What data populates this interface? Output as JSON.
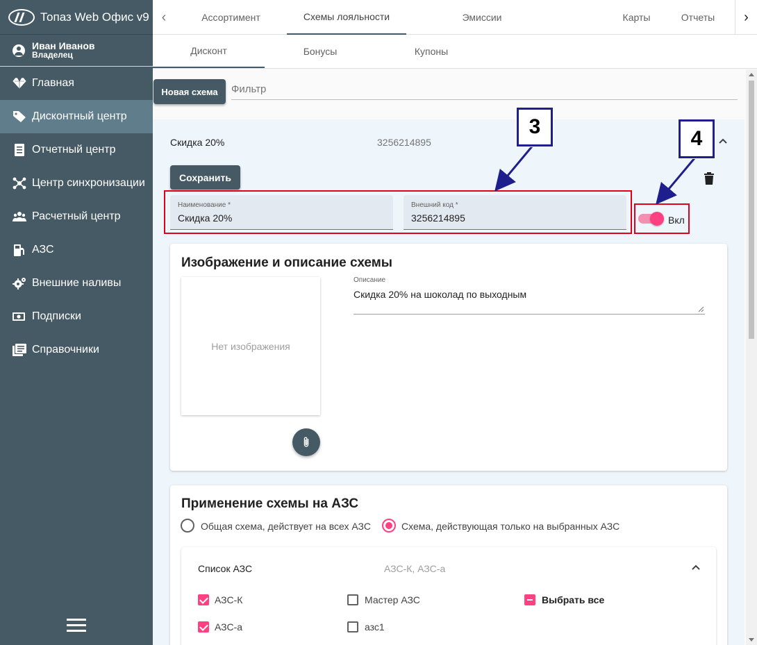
{
  "app": {
    "title": "Топаз Web Офис v9",
    "user_name": "Иван Иванов",
    "user_role": "Владелец"
  },
  "sidebar": {
    "items": [
      {
        "label": "Главная",
        "icon": "diamond-icon"
      },
      {
        "label": "Дисконтный центр",
        "icon": "tag-icon"
      },
      {
        "label": "Отчетный центр",
        "icon": "report-icon"
      },
      {
        "label": "Центр синхронизации",
        "icon": "sync-hub-icon"
      },
      {
        "label": "Расчетный центр",
        "icon": "people-icon"
      },
      {
        "label": "АЗС",
        "icon": "fuel-station-icon"
      },
      {
        "label": "Внешние наливы",
        "icon": "gear-icon"
      },
      {
        "label": "Подписки",
        "icon": "money-icon"
      },
      {
        "label": "Справочники",
        "icon": "library-icon"
      }
    ]
  },
  "top_tabs": [
    "Ассортимент",
    "Схемы лояльности",
    "Эмиссии",
    "Карты",
    "Отчеты"
  ],
  "sub_tabs": [
    "Дисконт",
    "Бонусы",
    "Купоны"
  ],
  "toolbar": {
    "new_scheme_label": "Новая схема",
    "filter_placeholder": "Фильтр"
  },
  "scheme": {
    "name": "Скидка 20%",
    "code": "3256214895",
    "save_label": "Сохранить",
    "name_field_label": "Наименование *",
    "name_field_value": "Скидка 20%",
    "code_field_label": "Внешний код *",
    "code_field_value": "3256214895",
    "toggle_label": "Вкл"
  },
  "image_card": {
    "title": "Изображение и описание схемы",
    "no_image": "Нет изображения",
    "description_label": "Описание",
    "description_value": "Скидка 20% на шоколад по выходным"
  },
  "stations_card": {
    "title": "Применение схемы на АЗС",
    "radio_all": "Общая схема, действует на всех АЗС",
    "radio_selected": "Схема, действующая только на выбранных АЗС",
    "list_title": "Список АЗС",
    "list_summary": "АЗС-К, АЗС-а",
    "stations": [
      {
        "label": "АЗС-К",
        "checked": true
      },
      {
        "label": "Мастер АЗС",
        "checked": false
      },
      {
        "label": "АЗС-а",
        "checked": true
      },
      {
        "label": "азс1",
        "checked": false
      }
    ],
    "select_all": "Выбрать все"
  },
  "annotations": {
    "callout_3": "3",
    "callout_4": "4"
  },
  "colors": {
    "sidebar": "#455a64",
    "accent": "#ff4081",
    "annotation_red": "#e0001b",
    "annotation_blue": "#1e1e8c"
  }
}
